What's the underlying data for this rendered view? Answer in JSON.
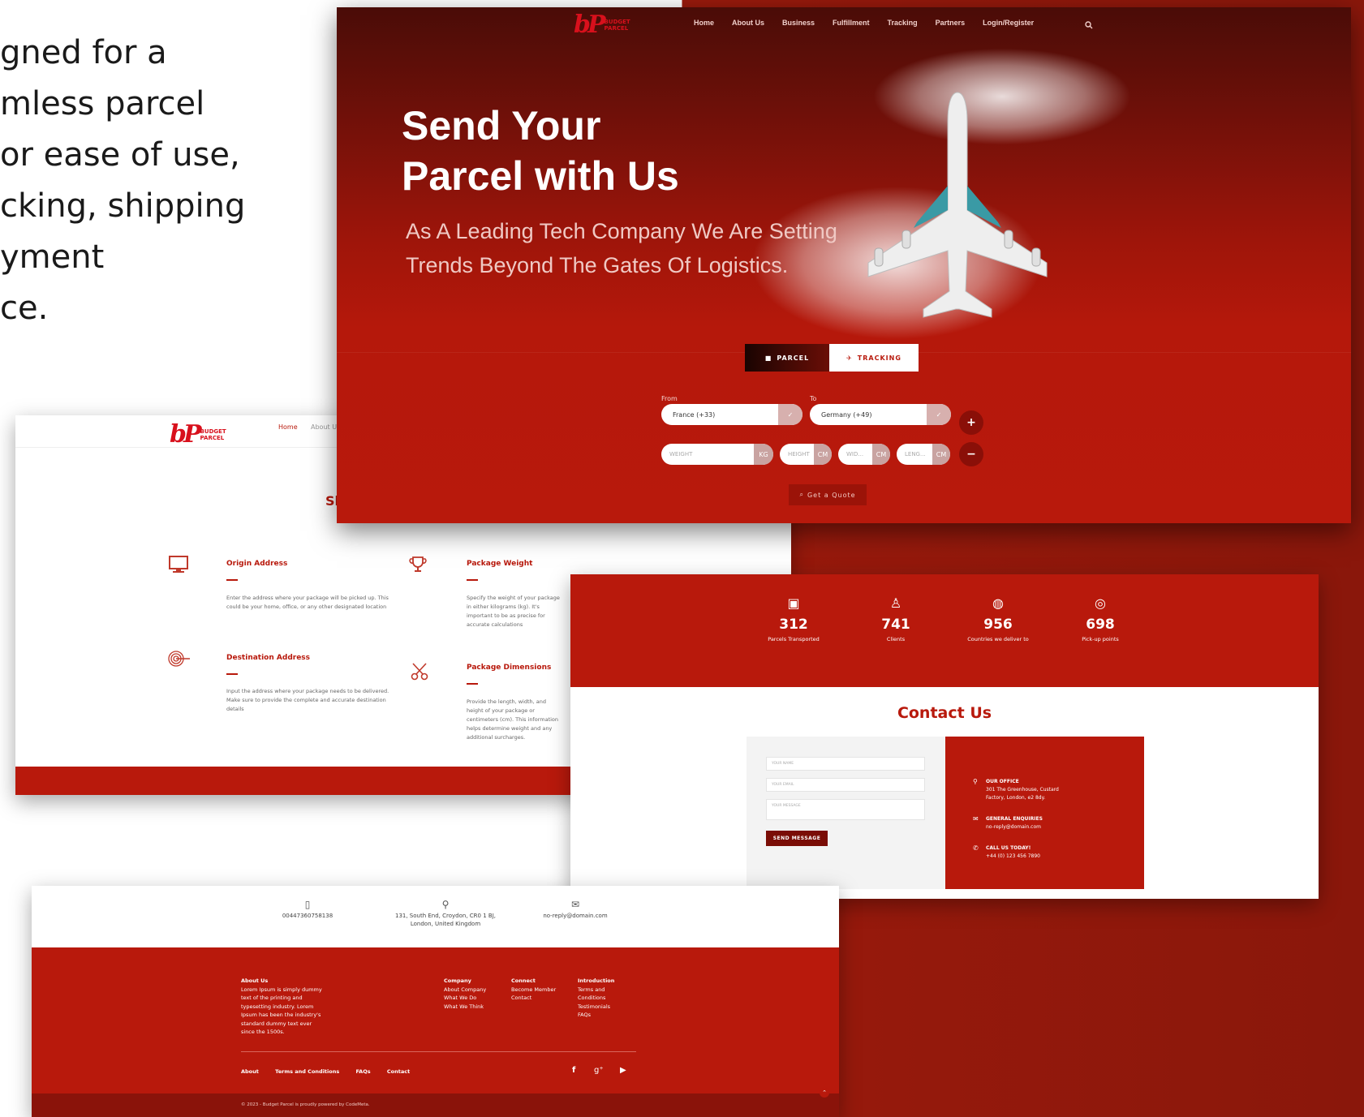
{
  "intro": {
    "line1": "gned for a",
    "line2": "mless parcel",
    "line3": "or ease of use,",
    "line4": "cking, shipping",
    "line5": "yment",
    "line6": "ce."
  },
  "hero": {
    "logo_mark": "bP",
    "logo_text_1": "BUDGET",
    "logo_text_2": "PARCEL",
    "nav": [
      "Home",
      "About Us",
      "Business",
      "Fulfillment",
      "Tracking",
      "Partners",
      "Login/Register"
    ],
    "title_line1": "Send Your",
    "title_line2": "Parcel with Us",
    "subtitle_line1": "As A Leading Tech Company We Are Setting",
    "subtitle_line2": "Trends Beyond The Gates Of Logistics.",
    "tab_parcel": "PARCEL",
    "tab_tracking": "TRACKING",
    "from_label": "From",
    "to_label": "To",
    "from_value": "France (+33)",
    "to_value": "Germany (+49)",
    "weight_ph": "WEIGHT",
    "weight_unit": "KG",
    "height_ph": "HEIGHT",
    "width_ph": "WID...",
    "length_ph": "LENG...",
    "cm": "CM",
    "quote_btn": "Get a Quote"
  },
  "features": {
    "nav_home": "Home",
    "nav_about": "About Us",
    "heading_fragment": "Sh",
    "items": [
      {
        "title": "Origin Address",
        "desc": "Enter the address where your package will be picked up. This could be your home, office, or any other designated location"
      },
      {
        "title": "Package Weight",
        "desc": "Specify the weight of your package in either kilograms (kg). It's important to be as precise for accurate calculations"
      },
      {
        "title": "Destination Address",
        "desc": "Input the address where your package needs to be delivered. Make sure to provide the complete and accurate destination details"
      },
      {
        "title": "Package Dimensions",
        "desc": "Provide the length, width, and height of your package or centimeters (cm). This information helps determine weight and any additional surcharges."
      }
    ]
  },
  "stats": [
    {
      "value": "312",
      "label": "Parcels Transported"
    },
    {
      "value": "741",
      "label": "Clients"
    },
    {
      "value": "956",
      "label": "Countries we deliver to"
    },
    {
      "value": "698",
      "label": "Pick-up points"
    }
  ],
  "contact": {
    "title": "Contact Us",
    "name_ph": "YOUR NAME",
    "email_ph": "YOUR EMAIL",
    "message_ph": "YOUR MESSAGE",
    "send": "SEND MESSAGE",
    "office_h": "OUR OFFICE",
    "office_1": "301 The Greenhouse, Custard",
    "office_2": "Factory, London, e2 8dy.",
    "enq_h": "GENERAL ENQUIRIES",
    "enq_v": "no-reply@domain.com",
    "call_h": "CALL US TODAY!",
    "call_v": "+44 (0) 123 456 7890"
  },
  "footer": {
    "phone": "00447360758138",
    "address_1": "131, South End, Croydon, CR0 1 BJ,",
    "address_2": "London, United Kingdom",
    "email": "no-reply@domain.com",
    "about_h": "About Us",
    "about_lines": [
      "Lorem Ipsum is simply dummy",
      "text of the printing and",
      "typesetting industry. Lorem",
      "Ipsum has been the industry's",
      "standard dummy text ever",
      "since the 1500s."
    ],
    "company_h": "Company",
    "company": [
      "About Company",
      "What We Do",
      "What We Think"
    ],
    "connect_h": "Connect",
    "connect": [
      "Become Member",
      "Contact"
    ],
    "intro_h": "Introduction",
    "intro": [
      "Terms and",
      "Conditions",
      "Testimonials",
      "FAQs"
    ],
    "links": [
      "About",
      "Terms and Conditions",
      "FAQs",
      "Contact"
    ],
    "copyright": "© 2023 - Budget Parcel is proudly powered by CodeMeta."
  }
}
